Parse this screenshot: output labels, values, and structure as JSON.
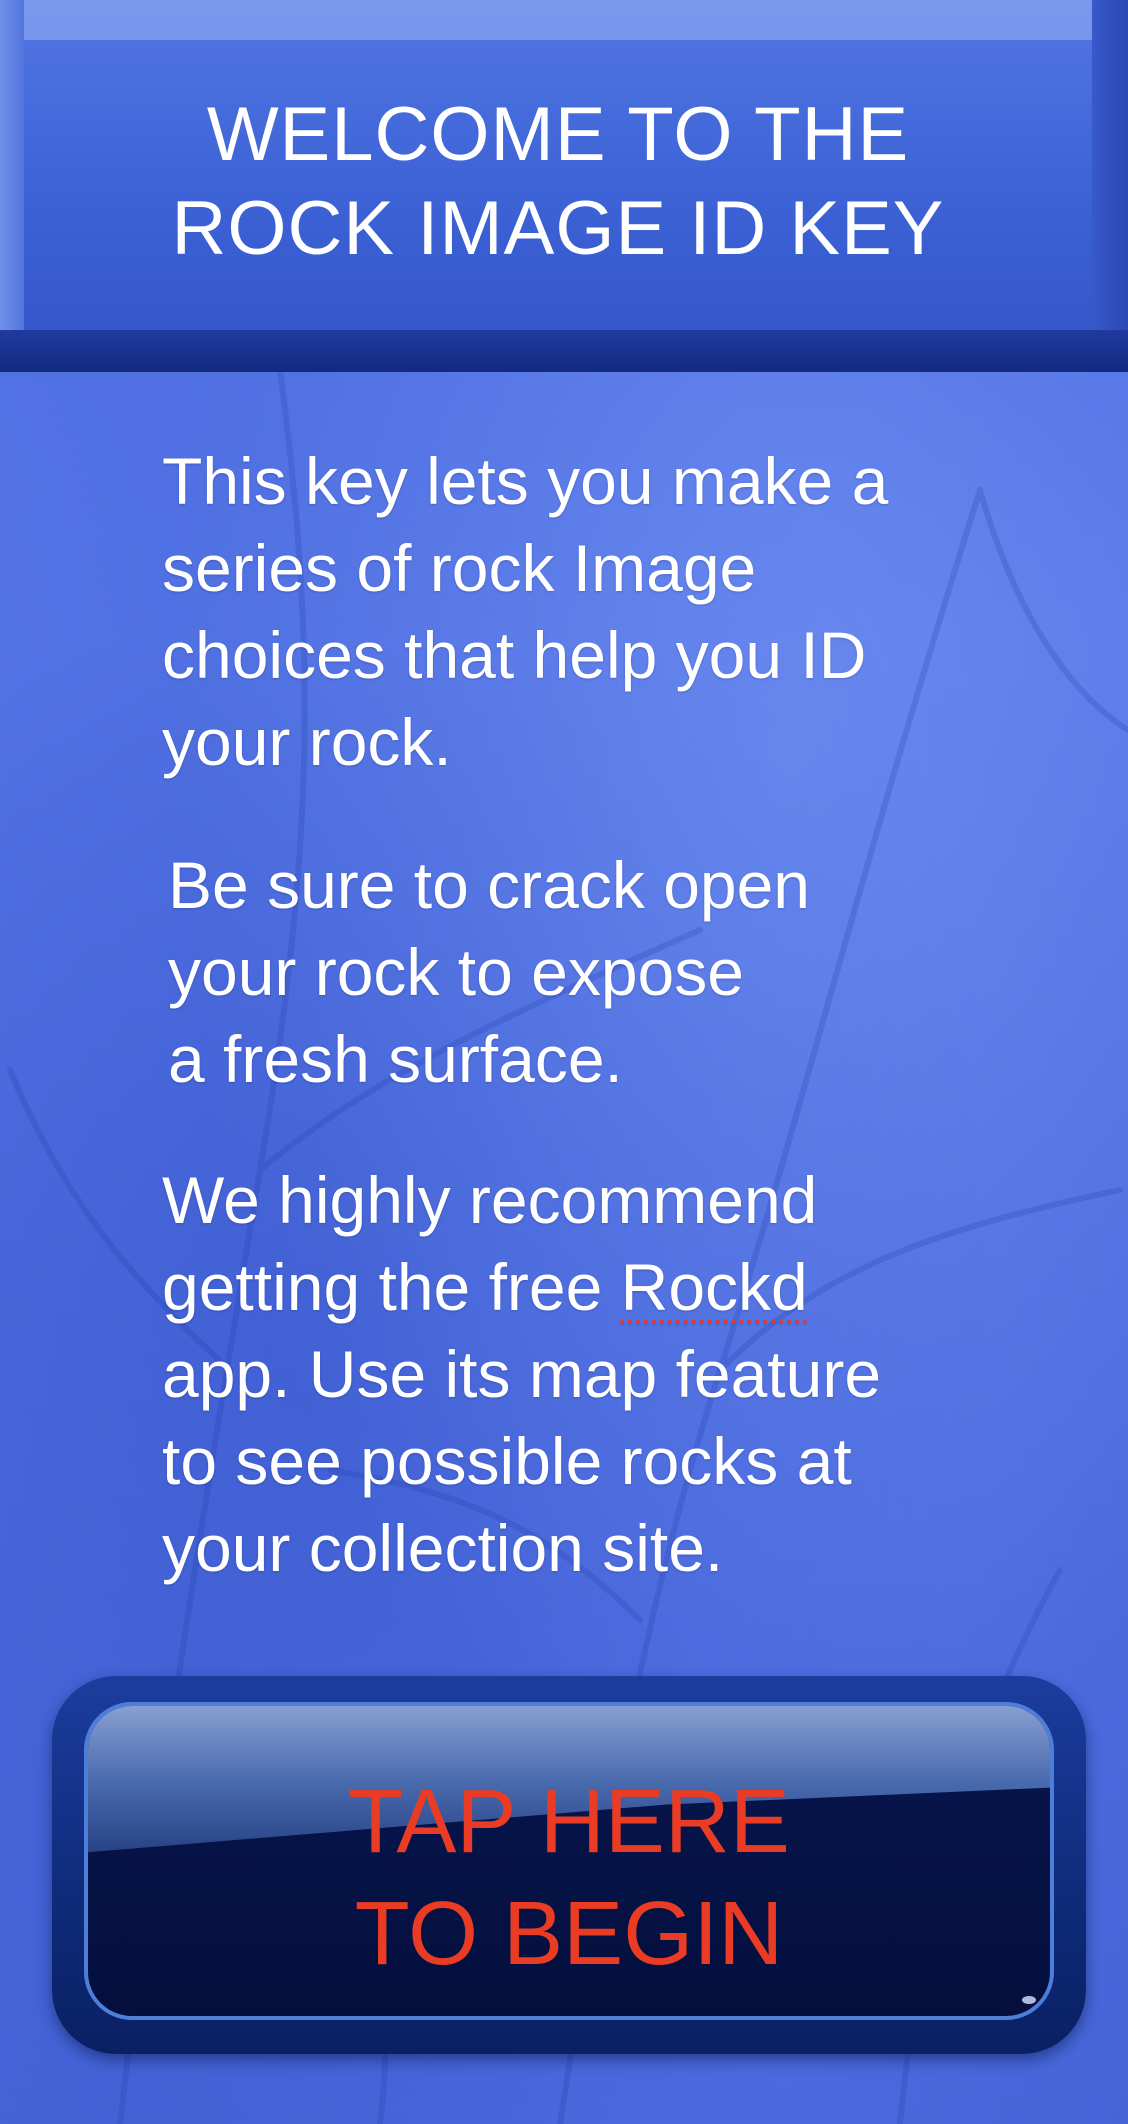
{
  "header": {
    "title": "WELCOME TO THE\nROCK IMAGE ID KEY"
  },
  "intro": {
    "paragraph_1": "This key lets you make a\nseries of  rock Image\nchoices that help you ID\nyour rock.",
    "paragraph_2": "Be sure to crack open\nyour rock to expose\na fresh surface.",
    "paragraph_3_before": "We highly recommend\ngetting the  free ",
    "paragraph_3_link": "Rockd",
    "paragraph_3_after": "\napp. Use its map feature\nto see possible rocks at\nyour collection  site."
  },
  "begin_button": {
    "label": "TAP HERE\nTO BEGIN"
  },
  "colors": {
    "background": "#4f6fe2",
    "header_face": "#4369da",
    "button": "#061448",
    "button_text": "#ea3c24",
    "text": "#ffffff"
  }
}
